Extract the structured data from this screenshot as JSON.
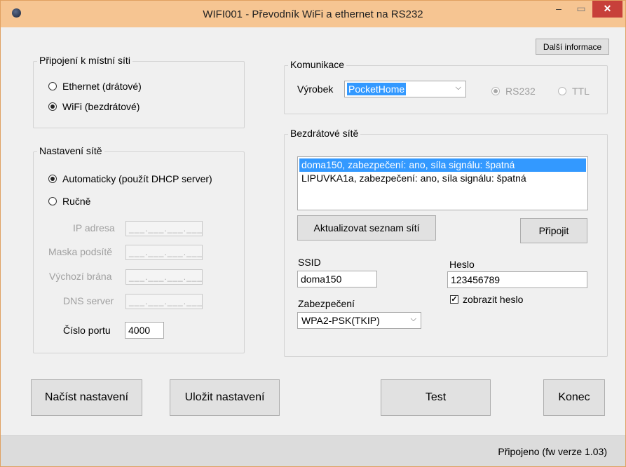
{
  "window": {
    "title": "WIFI001 - Převodník WiFi a ethernet na RS232",
    "minimize": "–",
    "maximize": "▭",
    "close": "✕"
  },
  "buttons": {
    "more_info": "Další informace",
    "refresh_networks": "Aktualizovat seznam sítí",
    "connect": "Připojit",
    "load": "Načíst nastavení",
    "save": "Uložit nastavení",
    "test": "Test",
    "exit": "Konec"
  },
  "local_network": {
    "legend": "Připojení k místní síti",
    "ethernet": "Ethernet (drátové)",
    "wifi": "WiFi (bezdrátové)",
    "selected": "wifi"
  },
  "network_settings": {
    "legend": "Nastavení sítě",
    "auto": "Automaticky (použít DHCP server)",
    "manual": "Ručně",
    "selected": "auto",
    "ip_label": "IP adresa",
    "mask_label": "Maska podsítě",
    "gateway_label": "Výchozí brána",
    "dns_label": "DNS server",
    "ip_placeholder": "___.___.___.___",
    "port_label": "Číslo portu",
    "port_value": "4000"
  },
  "communication": {
    "legend": "Komunikace",
    "product_label": "Výrobek",
    "product_value": "PocketHome",
    "rs232": "RS232",
    "ttl": "TTL",
    "selected": "rs232"
  },
  "wireless": {
    "legend": "Bezdrátové sítě",
    "networks": [
      "doma150, zabezpečení: ano, síla signálu: špatná",
      "LIPUVKA1a, zabezpečení: ano, síla signálu: špatná"
    ],
    "selected_index": 0,
    "ssid_label": "SSID",
    "ssid_value": "doma150",
    "password_label": "Heslo",
    "password_value": "123456789",
    "security_label": "Zabezpečení",
    "security_value": "WPA2-PSK(TKIP)",
    "show_password": "zobrazit heslo",
    "show_password_checked": true
  },
  "status": {
    "text": "Připojeno (fw verze 1.03)"
  }
}
